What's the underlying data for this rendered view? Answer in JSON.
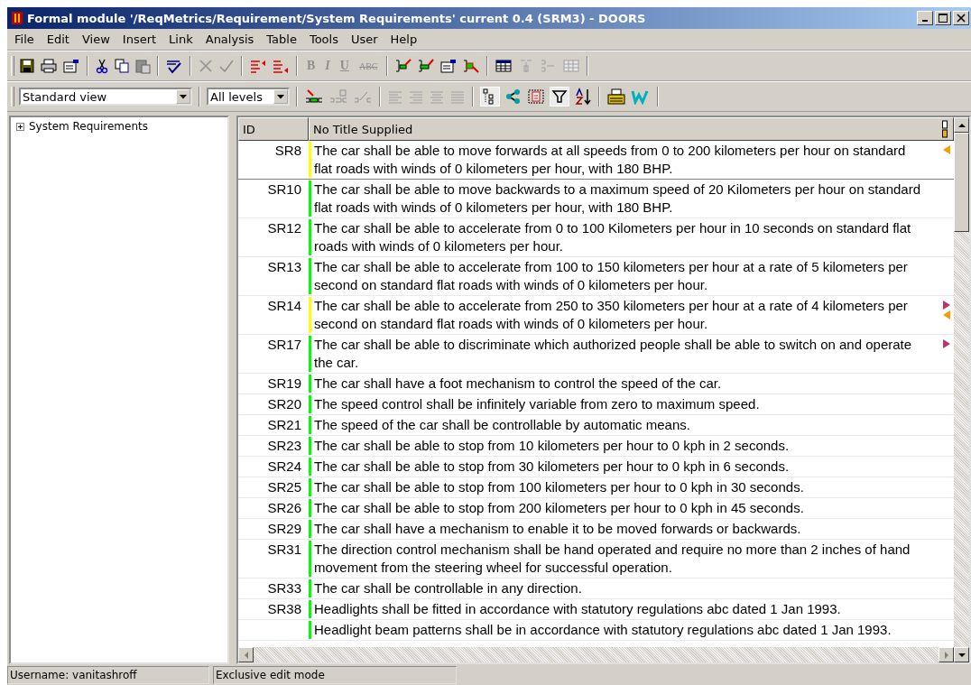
{
  "window": {
    "title": "Formal module '/ReqMetrics/Requirement/System Requirements' current 0.4 (SRM3) - DOORS"
  },
  "menu": [
    "File",
    "Edit",
    "View",
    "Insert",
    "Link",
    "Analysis",
    "Table",
    "Tools",
    "User",
    "Help"
  ],
  "format_buttons": [
    {
      "label": "B",
      "kind": "bold",
      "disabled": true
    },
    {
      "label": "I",
      "kind": "italic",
      "disabled": true
    },
    {
      "label": "U",
      "kind": "underline",
      "disabled": true
    },
    {
      "label": "ABC",
      "kind": "strike",
      "disabled": true
    }
  ],
  "view_select": {
    "value": "Standard view"
  },
  "level_select": {
    "value": "All levels"
  },
  "tree": [
    {
      "label": "System Requirements",
      "expanded": false
    }
  ],
  "table": {
    "columns": [
      "ID",
      "No Title Supplied"
    ],
    "rows": [
      {
        "id": "SR8",
        "text": "The car shall be able to move forwards at all speeds from 0 to 200 kilometers per hour on standard flat roads with winds of 0 kilometers per hour, with 180 BHP.",
        "color": "#ffff00",
        "selected": true,
        "links": [
          {
            "kind": "in"
          }
        ]
      },
      {
        "id": "SR10",
        "text": "The car shall be able to move backwards to a maximum speed of 20 Kilometers per hour on standard flat roads with winds of 0 kilometers per hour, with 180 BHP.",
        "color": "#00ff00",
        "selected": false,
        "links": []
      },
      {
        "id": "SR12",
        "text": "The car shall be able to accelerate from 0 to 100 Kilometers per hour in 10 seconds  on standard flat roads with winds of 0 kilometers per hour.",
        "color": "#00ff00",
        "selected": false,
        "links": []
      },
      {
        "id": "SR13",
        "text": "The car shall be able to accelerate from 100 to 150 kilometers per hour at a rate of 5 kilometers per second on standard flat roads with winds of 0 kilometers per hour.",
        "color": "#00ff00",
        "selected": false,
        "links": []
      },
      {
        "id": "SR14",
        "text": "The car shall be able to accelerate from 250 to 350 kilometers per hour at a rate of 4 kilometers per second on standard flat roads with winds of 0 kilometers per hour.",
        "color": "#ffff00",
        "selected": false,
        "links": [
          {
            "kind": "out"
          },
          {
            "kind": "in"
          }
        ]
      },
      {
        "id": "SR17",
        "text": "The car shall be able to discriminate which authorized people shall be able to switch on and operate the car.",
        "color": "#00ff00",
        "selected": false,
        "links": [
          {
            "kind": "out"
          }
        ]
      },
      {
        "id": "SR19",
        "text": "The car shall have a foot mechanism to control the speed of the car.",
        "color": "#00ff00",
        "selected": false,
        "links": []
      },
      {
        "id": "SR20",
        "text": "The speed control shall be infinitely variable from zero to maximum speed.",
        "color": "#00ff00",
        "selected": false,
        "links": []
      },
      {
        "id": "SR21",
        "text": "The speed of the car shall be controllable by automatic means.",
        "color": "#00ff00",
        "selected": false,
        "links": []
      },
      {
        "id": "SR23",
        "text": "The car shall be able to stop from 10 kilometers per hour to 0 kph in 2 seconds.",
        "color": "#00ff00",
        "selected": false,
        "links": []
      },
      {
        "id": "SR24",
        "text": "The car shall be able to stop from 30 kilometers per hour to 0 kph in 6 seconds.",
        "color": "#00ff00",
        "selected": false,
        "links": []
      },
      {
        "id": "SR25",
        "text": "The car shall be able to stop from 100 kilometers per hour to 0 kph in 30 seconds.",
        "color": "#00ff00",
        "selected": false,
        "links": []
      },
      {
        "id": "SR26",
        "text": "The car shall be able to stop from 200 kilometers per hour to 0 kph in 45 seconds.",
        "color": "#00ff00",
        "selected": false,
        "links": []
      },
      {
        "id": "SR29",
        "text": "The car shall have a mechanism to enable it to be moved forwards or backwards.",
        "color": "#00ff00",
        "selected": false,
        "links": []
      },
      {
        "id": "SR31",
        "text": "The direction control mechanism shall be hand operated and require no more than 2 inches of hand movement from the steering wheel for successful operation.",
        "color": "#00ff00",
        "selected": false,
        "links": []
      },
      {
        "id": "SR33",
        "text": "The car shall be controllable in any direction.",
        "color": "#00ff00",
        "selected": false,
        "links": []
      },
      {
        "id": "SR38",
        "text": "Headlights shall be fitted in accordance with statutory regulations abc dated 1 Jan 1993.",
        "color": "#00ff00",
        "selected": false,
        "links": []
      },
      {
        "id": "",
        "text": "Headlight beam patterns shall be in accordance with statutory regulations abc dated 1 Jan 1993.",
        "color": "#00ff00",
        "selected": false,
        "links": []
      }
    ]
  },
  "status_bar": [
    "Username: vanitashroff",
    "Exclusive edit mode"
  ]
}
